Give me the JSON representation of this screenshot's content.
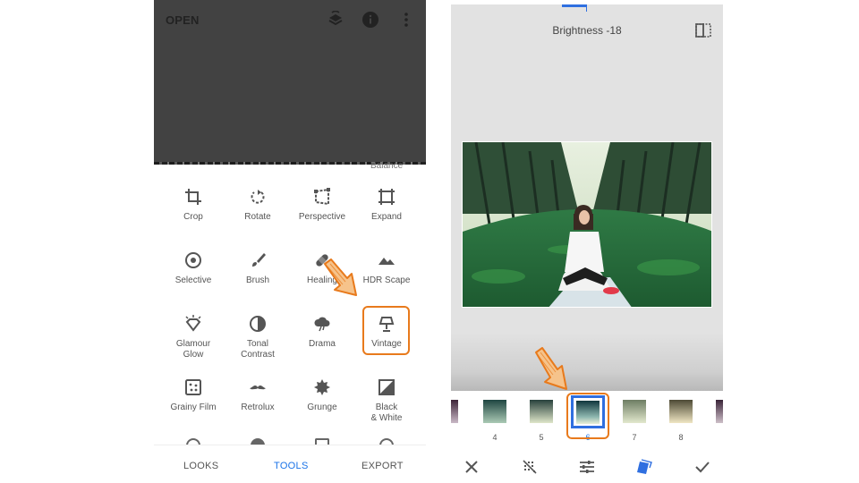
{
  "left": {
    "header": {
      "open_label": "OPEN"
    },
    "balance_partial": "Balance",
    "tools": [
      {
        "label": "Crop",
        "icon": "crop-icon"
      },
      {
        "label": "Rotate",
        "icon": "rotate-icon"
      },
      {
        "label": "Perspective",
        "icon": "perspective-icon"
      },
      {
        "label": "Expand",
        "icon": "expand-icon"
      },
      {
        "label": "Selective",
        "icon": "selective-icon"
      },
      {
        "label": "Brush",
        "icon": "brush-icon"
      },
      {
        "label": "Healing",
        "icon": "healing-icon"
      },
      {
        "label": "HDR Scape",
        "icon": "hdr-scape-icon"
      },
      {
        "label": "Glamour\nGlow",
        "icon": "glamour-glow-icon"
      },
      {
        "label": "Tonal\nContrast",
        "icon": "tonal-contrast-icon"
      },
      {
        "label": "Drama",
        "icon": "drama-icon"
      },
      {
        "label": "Vintage",
        "icon": "vintage-icon"
      },
      {
        "label": "Grainy Film",
        "icon": "grainy-film-icon"
      },
      {
        "label": "Retrolux",
        "icon": "retrolux-icon"
      },
      {
        "label": "Grunge",
        "icon": "grunge-icon"
      },
      {
        "label": "Black\n& White",
        "icon": "black-white-icon"
      }
    ],
    "tabs": {
      "looks": "LOOKS",
      "tools": "TOOLS",
      "export": "EXPORT"
    },
    "active_tab": "TOOLS"
  },
  "right": {
    "adjustment_label": "Brightness -18",
    "styles": [
      {
        "num": ""
      },
      {
        "num": "4"
      },
      {
        "num": "5"
      },
      {
        "num": "6"
      },
      {
        "num": "7"
      },
      {
        "num": "8"
      },
      {
        "num": ""
      }
    ],
    "selected_style": "6"
  },
  "colors": {
    "accent": "#1a73e8",
    "highlight": "#e87a1c",
    "header_dark": "#424242"
  }
}
